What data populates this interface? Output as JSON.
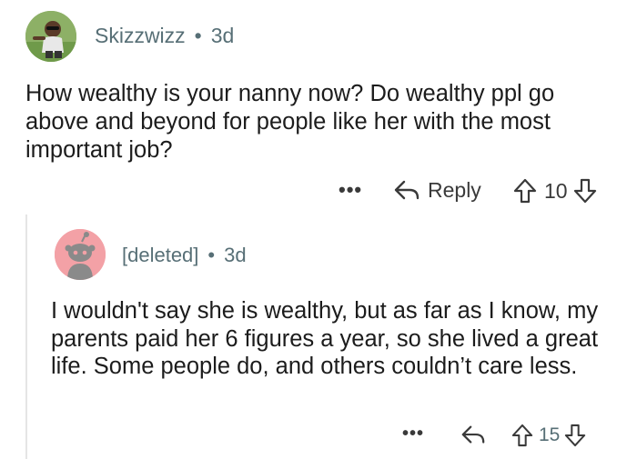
{
  "comment": {
    "author": "Skizzwizz",
    "separator": "•",
    "age": "3d",
    "text": "How wealthy is your nanny now? Do wealthy ppl go above and beyond for people like her with the most important job?",
    "actions": {
      "more_label": "•••",
      "reply_label": "Reply",
      "score": "10"
    }
  },
  "reply": {
    "author": "[deleted]",
    "separator": "•",
    "age": "3d",
    "text": "I wouldn't say she is wealthy, but as far as I know, my parents paid her 6 figures a year, so she lived a great life. Some people do, and others couldn’t care less.",
    "actions": {
      "more_label": "•••",
      "score": "15"
    }
  },
  "icons": {
    "reply": "reply-arrow-icon",
    "upvote": "upvote-arrow-icon",
    "downvote": "downvote-arrow-icon",
    "more": "more-dots-icon"
  },
  "colors": {
    "meta_text": "#576f76",
    "body_text": "#1c1c1c",
    "deleted_avatar_bg": "#f3a1a6",
    "thread_line": "#e5e5e5"
  }
}
